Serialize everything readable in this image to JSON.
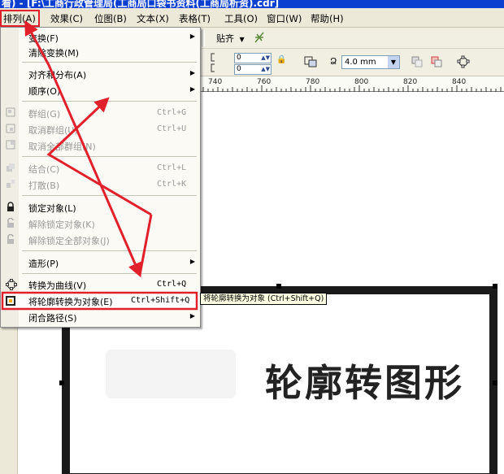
{
  "title_bar": {
    "text": "看) - [F:\\工商行政管理局(工商局口袋书资料(工商局析资).cdr]"
  },
  "menubar": {
    "items": [
      "排列(A)",
      "效果(C)",
      "位图(B)",
      "文本(X)",
      "表格(T)",
      "工具(O)",
      "窗口(W)",
      "帮助(H)"
    ]
  },
  "toolbar": {
    "snap_label": "贴齐",
    "field_a": "0",
    "field_b": "0",
    "outline_width": "4.0 mm"
  },
  "ruler": {
    "labels": [
      "740",
      "760",
      "780",
      "800",
      "820",
      "840"
    ]
  },
  "arrange_menu": {
    "items": [
      {
        "label": "变换(F)",
        "shortcut": "",
        "submenu": true,
        "enabled": true
      },
      {
        "label": "清除变换(M)",
        "shortcut": "",
        "submenu": false,
        "enabled": true
      },
      {
        "label": "对齐和分布(A)",
        "shortcut": "",
        "submenu": true,
        "enabled": true
      },
      {
        "label": "顺序(O)",
        "shortcut": "",
        "submenu": true,
        "enabled": true
      },
      {
        "label": "群组(G)",
        "shortcut": "Ctrl+G",
        "submenu": false,
        "enabled": false
      },
      {
        "label": "取消群组(U)",
        "shortcut": "Ctrl+U",
        "submenu": false,
        "enabled": false
      },
      {
        "label": "取消全部群组(N)",
        "shortcut": "",
        "submenu": false,
        "enabled": false
      },
      {
        "label": "结合(C)",
        "shortcut": "Ctrl+L",
        "submenu": false,
        "enabled": false
      },
      {
        "label": "打散(B)",
        "shortcut": "Ctrl+K",
        "submenu": false,
        "enabled": false
      },
      {
        "label": "锁定对象(L)",
        "shortcut": "",
        "submenu": false,
        "enabled": true
      },
      {
        "label": "解除锁定对象(K)",
        "shortcut": "",
        "submenu": false,
        "enabled": false
      },
      {
        "label": "解除锁定全部对象(J)",
        "shortcut": "",
        "submenu": false,
        "enabled": false
      },
      {
        "label": "造形(P)",
        "shortcut": "",
        "submenu": true,
        "enabled": true
      },
      {
        "label": "转换为曲线(V)",
        "shortcut": "Ctrl+Q",
        "submenu": false,
        "enabled": true
      },
      {
        "label": "将轮廓转换为对象(E)",
        "shortcut": "Ctrl+Shift+Q",
        "submenu": false,
        "enabled": true
      },
      {
        "label": "闭合路径(S)",
        "shortcut": "",
        "submenu": true,
        "enabled": true
      }
    ]
  },
  "tooltip": {
    "text": "将轮廓转换为对象 (Ctrl+Shift+Q)"
  },
  "canvas": {
    "shape_text": "轮廓转图形"
  },
  "colors": {
    "highlight_box": "#e0202a",
    "arrow": "#e0202a",
    "titlebar": "#0a3fd0"
  },
  "icons": [
    "lock-icon",
    "unlock-icon",
    "curve-icon",
    "outline-to-object-icon",
    "group-icon",
    "combine-icon",
    "node-icon"
  ]
}
